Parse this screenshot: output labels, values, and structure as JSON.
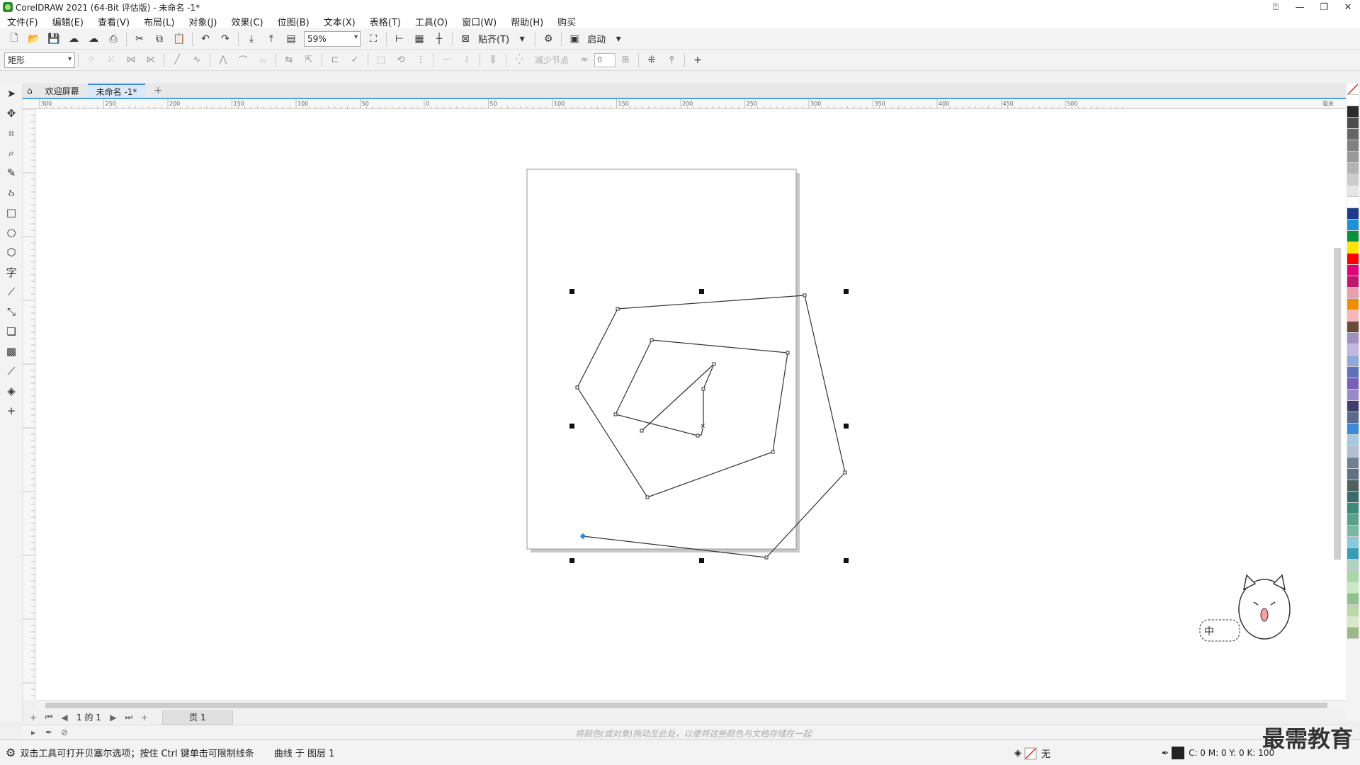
{
  "window": {
    "title": "CorelDRAW 2021 (64-Bit 评估版) - 未命名 -1*",
    "minimize": "—",
    "restore": "❐",
    "close": "✕"
  },
  "menu": [
    "文件(F)",
    "编辑(E)",
    "查看(V)",
    "布局(L)",
    "对象(J)",
    "效果(C)",
    "位图(B)",
    "文本(X)",
    "表格(T)",
    "工具(O)",
    "窗口(W)",
    "帮助(H)",
    "购买"
  ],
  "toolbar": {
    "zoom": "59%",
    "snap_label": "贴齐(T)",
    "launch_label": "启动"
  },
  "property_bar": {
    "shape_type": "矩形",
    "reduce_nodes": "减少节点",
    "smoothness": "0"
  },
  "tabs": {
    "welcome": "欢迎屏幕",
    "document": "未命名 -1*",
    "add": "+"
  },
  "ruler": {
    "h_labels": [
      "300",
      "250",
      "200",
      "150",
      "100",
      "50",
      "0",
      "50",
      "100",
      "150",
      "200",
      "250",
      "300",
      "350",
      "400",
      "450",
      "500"
    ],
    "unit": "毫米"
  },
  "page_nav": {
    "page_count": "1 的 1",
    "page_tab": "页 1"
  },
  "color_bar": {
    "drag_hint": "将颜色(或对象)拖动至此处，以便将这些颜色与文档存储在一起"
  },
  "status": {
    "hint": "双击工具可打开贝塞尔选项；按住 Ctrl 键单击可限制线条",
    "object_info": "曲线 于 图层 1",
    "fill": "无",
    "cmyk": "C: 0 M: 0 Y: 0 K: 100"
  },
  "watermark": "最需教育",
  "mascot_text": "中",
  "colors": {
    "accent": "#3a8be0",
    "palette": [
      "#ffffff",
      "#2b2b2b",
      "#4d4d4d",
      "#666666",
      "#808080",
      "#999999",
      "#b3b3b3",
      "#cccccc",
      "#e6e6e6",
      "#ffffff",
      "#1e3a8a",
      "#1e90d6",
      "#0a8f3c",
      "#ffe600",
      "#ff0000",
      "#e0007a",
      "#c2186b",
      "#e8a0b0",
      "#f08c00",
      "#f5b8b8",
      "#6a4a3a",
      "#a090c0",
      "#c0b8e0",
      "#8fa8d8",
      "#5f6fb8",
      "#7a5fb8",
      "#9a88c8",
      "#3f3f6f",
      "#5a6a8a",
      "#3a8ad8",
      "#a8c8e0",
      "#b0c0d0",
      "#708090",
      "#607080",
      "#506060",
      "#3a6a6a",
      "#3a8a7a",
      "#5aa08a",
      "#78b8a0",
      "#88c8d8",
      "#3a9ab8",
      "#b0d0c0",
      "#a8d8a8",
      "#c8e8c8",
      "#90c090",
      "#b8d8a8",
      "#d8e8c8",
      "#9ab888"
    ]
  }
}
